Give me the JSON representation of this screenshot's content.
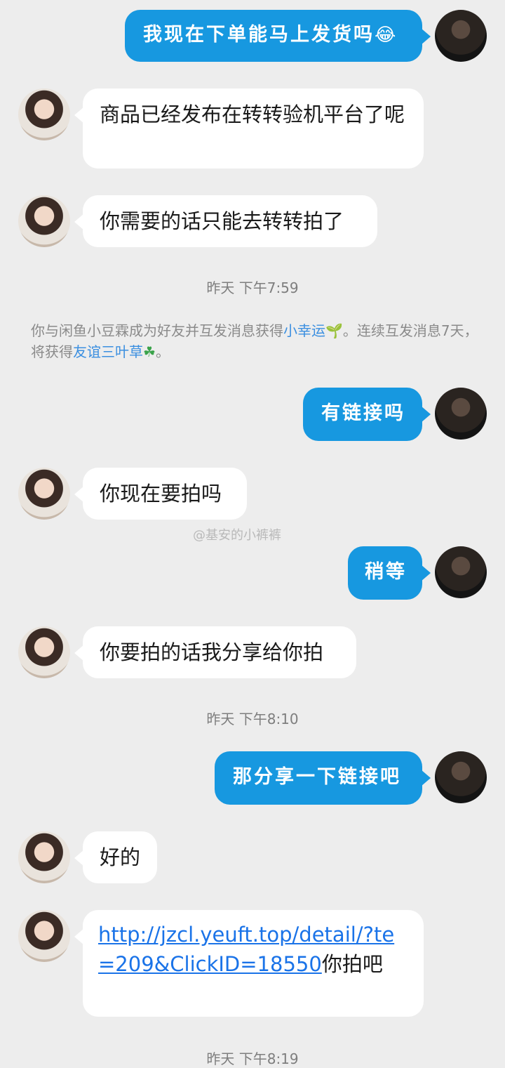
{
  "messages": [
    {
      "side": "me",
      "text": "我现在下单能马上发货吗",
      "emoji": "😂"
    },
    {
      "side": "her",
      "text": "商品已经发布在转转验机平台了呢"
    },
    {
      "side": "her",
      "text": "你需要的话只能去转转拍了"
    },
    {
      "side": "me",
      "text": "有链接吗"
    },
    {
      "side": "her",
      "text": "你现在要拍吗"
    },
    {
      "side": "me",
      "text": "稍等"
    },
    {
      "side": "her",
      "text": "你要拍的话我分享给你拍"
    },
    {
      "side": "me",
      "text": "那分享一下链接吧"
    },
    {
      "side": "her",
      "text": "好的"
    },
    {
      "side": "her",
      "link": "http://jzcl.yeuft.top/detail/?te=209&ClickID=18550",
      "after_link": "你拍吧"
    }
  ],
  "timestamps": [
    "昨天 下午7:59",
    "昨天 下午8:10",
    "昨天 下午8:19"
  ],
  "system_notice": {
    "part1": "你与闲鱼小豆霖成为好友并互发消息获得",
    "lucky": "小幸运",
    "lucky_emoji": "🌱",
    "part2": "。连续互发消息7天，将获得",
    "clover": "友谊三叶草",
    "clover_emoji": "☘",
    "part3": "。"
  },
  "watermark": "@基安的小裤裤"
}
